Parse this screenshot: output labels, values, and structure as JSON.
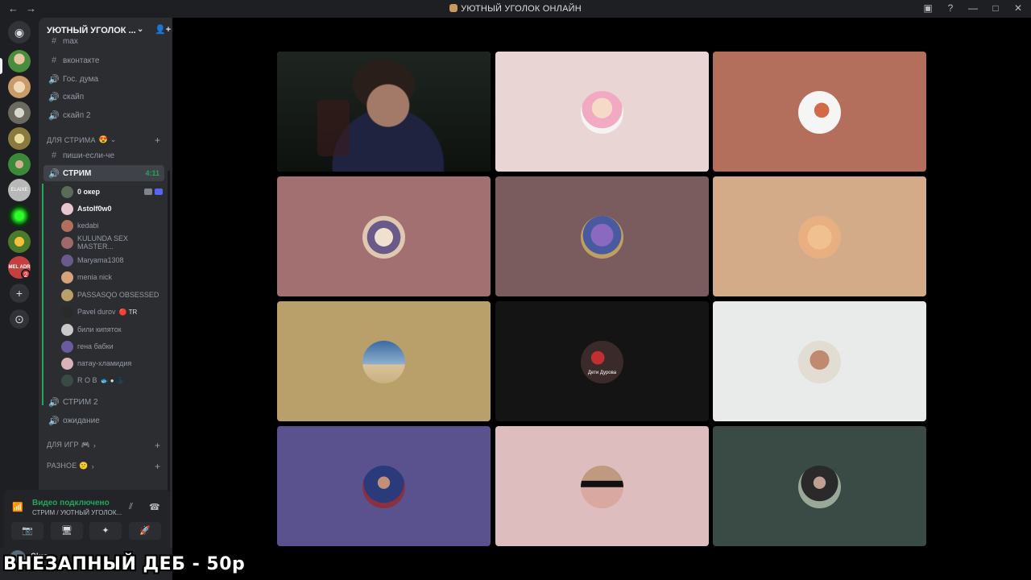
{
  "window": {
    "title": "УЮТНЫЙ УГОЛОК ОНЛАЙН",
    "nav_back": "←",
    "nav_forward": "→",
    "controls": [
      "▣",
      "?",
      "—",
      "□",
      "✕"
    ]
  },
  "server": {
    "name": "УЮТНЫЙ УГОЛОК ...",
    "chevron": "⌄",
    "add_user": "👤+"
  },
  "guilds": [
    {
      "name": "discord-home",
      "glyph": "◉"
    },
    {
      "name": "guild-1"
    },
    {
      "name": "guild-2"
    },
    {
      "name": "guild-3"
    },
    {
      "name": "guild-4"
    },
    {
      "name": "guild-5"
    },
    {
      "name": "guild-6",
      "label": "ELAIXE"
    },
    {
      "name": "guild-7"
    },
    {
      "name": "guild-8"
    },
    {
      "name": "guild-9",
      "label": "MEL ADR",
      "badge": "2"
    }
  ],
  "add_server": "+",
  "explore": "⊙",
  "channels": {
    "top": [
      {
        "icon": "#",
        "label": "max"
      },
      {
        "icon": "#",
        "label": "вконтакте"
      },
      {
        "icon": "🔊",
        "label": "Гос. дума"
      },
      {
        "icon": "🔊",
        "label": "скайп"
      },
      {
        "icon": "🔊",
        "label": "скайп 2"
      }
    ],
    "category_stream": "ДЛЯ СТРИМА",
    "stream_section": [
      {
        "icon": "#",
        "label": "пиши-если-че"
      }
    ],
    "active": {
      "icon": "🔊",
      "label": "СТРИМ",
      "timer": "4:11"
    },
    "members": [
      {
        "name": "0 окер",
        "bold": true,
        "color": "#5a6b5a",
        "icons": true
      },
      {
        "name": "Astolf0w0",
        "bold": true,
        "color": "#e9c6cf"
      },
      {
        "name": "kedabi",
        "color": "#b46e5c"
      },
      {
        "name": "KULUNDA SEX MASTER...",
        "color": "#9d6a6c"
      },
      {
        "name": "Maryama1308",
        "color": "#6a5a8a"
      },
      {
        "name": "menia nick",
        "color": "#d9a37a"
      },
      {
        "name": "PASSASQO OBSESSED",
        "color": "#b9a06b"
      },
      {
        "name": "Pavel durov",
        "color": "#2a2a2a",
        "tag": "🔴 TR"
      },
      {
        "name": "били кипяток",
        "color": "#c9c9c9"
      },
      {
        "name": "гена бабки",
        "color": "#6a5ba0"
      },
      {
        "name": "патау-хламидия",
        "color": "#d9b3b8"
      },
      {
        "name": "R O B",
        "color": "#3a4a44",
        "tag": "🐟 ● 🌑"
      }
    ],
    "after": [
      {
        "icon": "🔊",
        "label": "СТРИМ 2"
      },
      {
        "icon": "🔊",
        "label": "ожидание"
      }
    ],
    "category_games": "ДЛЯ ИГР 🎮",
    "category_misc": "РАЗНОЕ 😕"
  },
  "voice": {
    "status": "Видео подключено",
    "location": "СТРИМ / УЮТНЫЙ УГОЛОК...",
    "buttons": [
      "📷",
      "🖥",
      "✦",
      "🚀"
    ]
  },
  "user": {
    "name": "Oker"
  },
  "overlay": "ВНЕЗАПНЫЙ ДЕБ - 50р",
  "tiles": [
    {
      "name": "tile-camera",
      "bg": "#0f1311",
      "camera": true,
      "speaking": true
    },
    {
      "name": "tile-astolfo",
      "bg": "#e9d5d4",
      "avatar": "#f2c8d6"
    },
    {
      "name": "tile-kedabi",
      "bg": "#b46e5c",
      "avatar": "#f5f5f5"
    },
    {
      "name": "tile-kulunda",
      "bg": "#a27070",
      "avatar": "#e8d6c8"
    },
    {
      "name": "tile-maryama",
      "bg": "#7a5b5e",
      "avatar": "#6b5aa0"
    },
    {
      "name": "tile-menia",
      "bg": "#d4ab88",
      "avatar": "#e6b48a"
    },
    {
      "name": "tile-passasqo",
      "bg": "#b9a06b",
      "avatar": "#8fa8c6"
    },
    {
      "name": "tile-pavel",
      "bg": "#141414",
      "avatar": "#3a2a2a",
      "caption": "Дети Дурова"
    },
    {
      "name": "tile-kipyatok",
      "bg": "#e9eaea",
      "avatar": "#e2ddd2"
    },
    {
      "name": "tile-gena",
      "bg": "#5a528f",
      "avatar": "#8a3040"
    },
    {
      "name": "tile-patau",
      "bg": "#ddbdbe",
      "avatar": "#d0a6a2"
    },
    {
      "name": "tile-rob",
      "bg": "#3a4a44",
      "avatar": "#8a9a8a"
    }
  ]
}
